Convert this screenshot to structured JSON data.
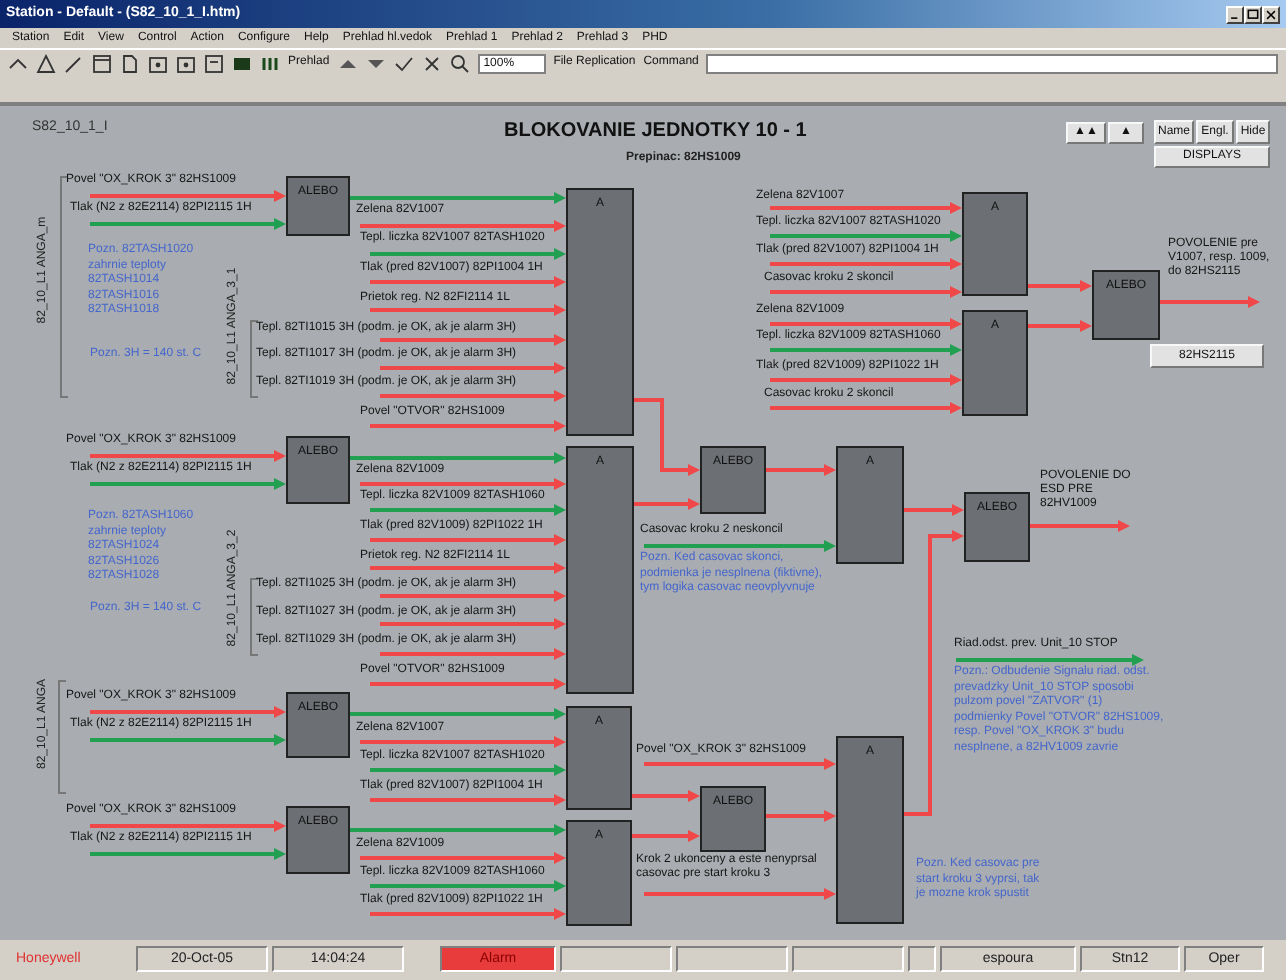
{
  "window": {
    "title": "Station - Default - (S82_10_1_I.htm)"
  },
  "menu": [
    "Station",
    "Edit",
    "View",
    "Control",
    "Action",
    "Configure",
    "Help",
    "Prehlad hl.vedok",
    "Prehlad 1",
    "Prehlad 2",
    "Prehlad 3",
    "PHD"
  ],
  "toolbar": {
    "view_label": "Prehlad",
    "zoom": "100%",
    "file_replication": "File Replication",
    "command_label": "Command"
  },
  "diagram": {
    "sheet_id": "S82_10_1_I",
    "title": "BLOKOVANIE JEDNOTKY 10 - 1",
    "subtitle": "Prepinac: 82HS1009",
    "nav_buttons": [
      "▲▲",
      "▲"
    ],
    "view_buttons": [
      "Name",
      "Engl.",
      "Hide"
    ],
    "displays_button": "DISPLAYS",
    "output_button": "82HS2115",
    "group_labels": [
      "82_10_L1 ANGA_m",
      "82_10_L1 ANGA_3_1",
      "82_10_L1 ANGA_3_2",
      "82_10_L1 ANGA"
    ],
    "blocks": [
      {
        "label": "ALEBO"
      },
      {
        "label": "A"
      },
      {
        "label": "ALEBO"
      },
      {
        "label": "A"
      },
      {
        "label": "ALEBO"
      },
      {
        "label": "A"
      },
      {
        "label": "ALEBO"
      },
      {
        "label": "A"
      },
      {
        "label": "A"
      },
      {
        "label": "A"
      },
      {
        "label": "ALEBO"
      },
      {
        "label": "ALEBO"
      },
      {
        "label": "A"
      },
      {
        "label": "ALEBO"
      },
      {
        "label": "A"
      },
      {
        "label": "ALEBO"
      }
    ],
    "signals": [
      {
        "text": "Povel \"OX_KROK 3\" 82HS1009",
        "color": "#f04848"
      },
      {
        "text": "Tlak (N2 z 82E2114) 82PI2115 1H",
        "color": "#20a050"
      },
      {
        "text": "Zelena 82V1007",
        "color": "#f04848"
      },
      {
        "text": "Tepl. liczka 82V1007 82TASH1020",
        "color": "#20a050"
      },
      {
        "text": "Tlak (pred 82V1007) 82PI1004 1H",
        "color": "#f04848"
      },
      {
        "text": "Prietok reg. N2 82FI2114 1L",
        "color": "#f04848"
      },
      {
        "text": "Tepl. 82TI1015 3H (podm. je OK, ak je alarm 3H)",
        "color": "#f04848"
      },
      {
        "text": "Tepl. 82TI1017 3H (podm. je OK, ak je alarm 3H)",
        "color": "#f04848"
      },
      {
        "text": "Tepl. 82TI1019 3H (podm. je OK, ak je alarm 3H)",
        "color": "#f04848"
      },
      {
        "text": "Povel \"OTVOR\" 82HS1009",
        "color": "#f04848"
      },
      {
        "text": "Povel \"OX_KROK 3\" 82HS1009",
        "color": "#f04848"
      },
      {
        "text": "Tlak (N2 z 82E2114) 82PI2115 1H",
        "color": "#20a050"
      },
      {
        "text": "Zelena 82V1009",
        "color": "#f04848"
      },
      {
        "text": "Tepl. liczka 82V1009 82TASH1060",
        "color": "#20a050"
      },
      {
        "text": "Tlak (pred 82V1009) 82PI1022 1H",
        "color": "#f04848"
      },
      {
        "text": "Prietok reg. N2 82FI2114 1L",
        "color": "#f04848"
      },
      {
        "text": "Tepl. 82TI1025 3H (podm. je OK, ak je alarm 3H)",
        "color": "#f04848"
      },
      {
        "text": "Tepl. 82TI1027 3H (podm. je OK, ak je alarm 3H)",
        "color": "#f04848"
      },
      {
        "text": "Tepl. 82TI1029 3H (podm. je OK, ak je alarm 3H)",
        "color": "#f04848"
      },
      {
        "text": "Povel \"OTVOR\" 82HS1009",
        "color": "#f04848"
      },
      {
        "text": "Povel \"OX_KROK 3\" 82HS1009",
        "color": "#f04848"
      },
      {
        "text": "Tlak (N2 z 82E2114) 82PI2115 1H",
        "color": "#20a050"
      },
      {
        "text": "Zelena 82V1007",
        "color": "#f04848"
      },
      {
        "text": "Tepl. liczka 82V1007 82TASH1020",
        "color": "#20a050"
      },
      {
        "text": "Tlak (pred 82V1007) 82PI1004 1H",
        "color": "#f04848"
      },
      {
        "text": "Povel \"OX_KROK 3\" 82HS1009",
        "color": "#f04848"
      },
      {
        "text": "Tlak (N2 z 82E2114) 82PI2115 1H",
        "color": "#20a050"
      },
      {
        "text": "Zelena 82V1009",
        "color": "#f04848"
      },
      {
        "text": "Tepl. liczka 82V1009 82TASH1060",
        "color": "#20a050"
      },
      {
        "text": "Tlak (pred 82V1009) 82PI1022 1H",
        "color": "#f04848"
      },
      {
        "text": "Zelena 82V1007",
        "color": "#f04848"
      },
      {
        "text": "Tepl. liczka 82V1007 82TASH1020",
        "color": "#20a050"
      },
      {
        "text": "Tlak (pred 82V1007) 82PI1004 1H",
        "color": "#f04848"
      },
      {
        "text": "Casovac kroku 2 skoncil",
        "color": "#f04848"
      },
      {
        "text": "Zelena 82V1009",
        "color": "#f04848"
      },
      {
        "text": "Tepl. liczka 82V1009 82TASH1060",
        "color": "#20a050"
      },
      {
        "text": "Tlak (pred 82V1009) 82PI1022 1H",
        "color": "#f04848"
      },
      {
        "text": "Casovac kroku 2 skoncil",
        "color": "#f04848"
      },
      {
        "text": "Casovac kroku 2 neskoncil",
        "color": "#20a050"
      },
      {
        "text": "Riad.odst. prev. Unit_10 STOP",
        "color": "#20a050"
      },
      {
        "text": "Povel \"OX_KROK 3\" 82HS1009",
        "color": "#f04848"
      },
      {
        "text": "Krok 2 ukonceny a este nenyprsal\ncasovac pre start kroku 3",
        "color": "#f04848"
      },
      {
        "text": "POVOLENIE pre\nV1007, resp. 1009,\ndo 82HS2115",
        "color": "#f04848"
      },
      {
        "text": "POVOLENIE DO\nESD PRE\n82HV1009",
        "color": "#f04848"
      }
    ],
    "links": [
      {
        "color": "#20a050"
      },
      {
        "color": "#20a050"
      },
      {
        "color": "#20a050"
      },
      {
        "color": "#20a050"
      },
      {
        "color": "#f04848"
      },
      {
        "color": "#f04848"
      },
      {
        "color": "#f04848"
      },
      {
        "color": "#f04848"
      },
      {
        "color": "#f04848"
      },
      {
        "color": "#f04848"
      },
      {
        "color": "#f04848"
      },
      {
        "color": "#f04848"
      },
      {
        "color": "#f04848"
      },
      {
        "color": "#f04848"
      }
    ],
    "notes": [
      "Pozn. 82TASH1020\nzahrnie teploty\n82TASH1014\n82TASH1016\n82TASH1018",
      "Pozn. 3H = 140 st. C",
      "Pozn. 82TASH1060\nzahrnie teploty\n82TASH1024\n82TASH1026\n82TASH1028",
      "Pozn. 3H = 140 st. C",
      "Pozn. Ked casovac skonci,\npodmienka je nesplnena (fiktivne),\ntym logika casovac neovplyvnuje",
      "Pozn.: Odbudenie Signalu riad. odst.\nprevadzky Unit_10 STOP sposobi\npulzom povel \"ZATVOR\" (1)\npodmienky Povel \"OTVOR\" 82HS1009,\nresp. Povel \"OX_KROK 3\" budu\nnesplnene, a 82HV1009 zavrie",
      "Pozn. Ked casovac pre\nstart kroku 3 vyprsi, tak\nje mozne krok spustit"
    ]
  },
  "status_bar": {
    "brand": "Honeywell",
    "cells": [
      {
        "text": "20-Oct-05",
        "alarm": false
      },
      {
        "text": "14:04:24",
        "alarm": false
      },
      {
        "text": "Alarm",
        "alarm": true
      },
      {
        "text": "espoura",
        "alarm": false
      },
      {
        "text": "Stn12",
        "alarm": false
      },
      {
        "text": "Oper",
        "alarm": false
      }
    ]
  }
}
